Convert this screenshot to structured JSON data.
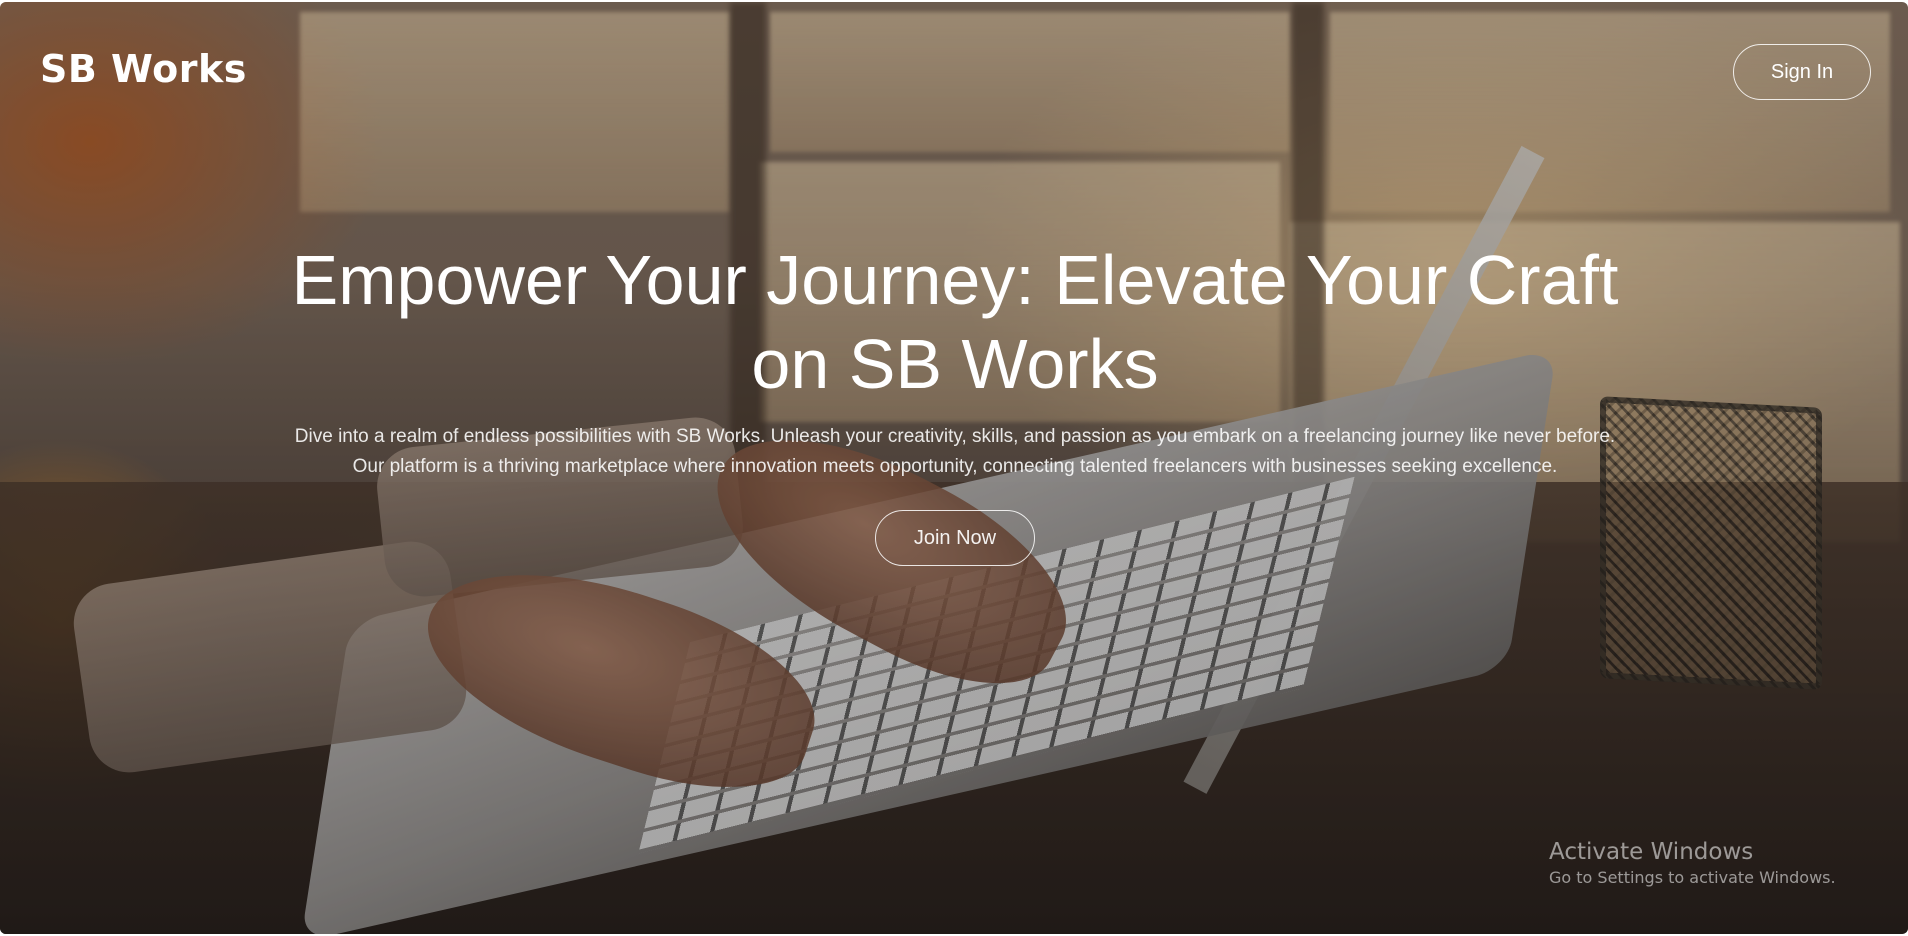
{
  "header": {
    "brand": "SB Works",
    "signin_label": "Sign In"
  },
  "hero": {
    "title": "Empower Your Journey: Elevate Your Craft on SB Works",
    "description": "Dive into a realm of endless possibilities with SB Works. Unleash your creativity, skills, and passion as you embark on a freelancing journey like never before. Our platform is a thriving marketplace where innovation meets opportunity, connecting talented freelancers with businesses seeking excellence.",
    "cta_label": "Join Now",
    "background_image": "woman-typing-on-laptop-photo"
  },
  "system_watermark": {
    "title": "Activate Windows",
    "subtitle": "Go to Settings to activate Windows."
  },
  "colors": {
    "text": "#ffffff",
    "button_border": "#ffffff",
    "photo_warm": "#c98a3a"
  }
}
